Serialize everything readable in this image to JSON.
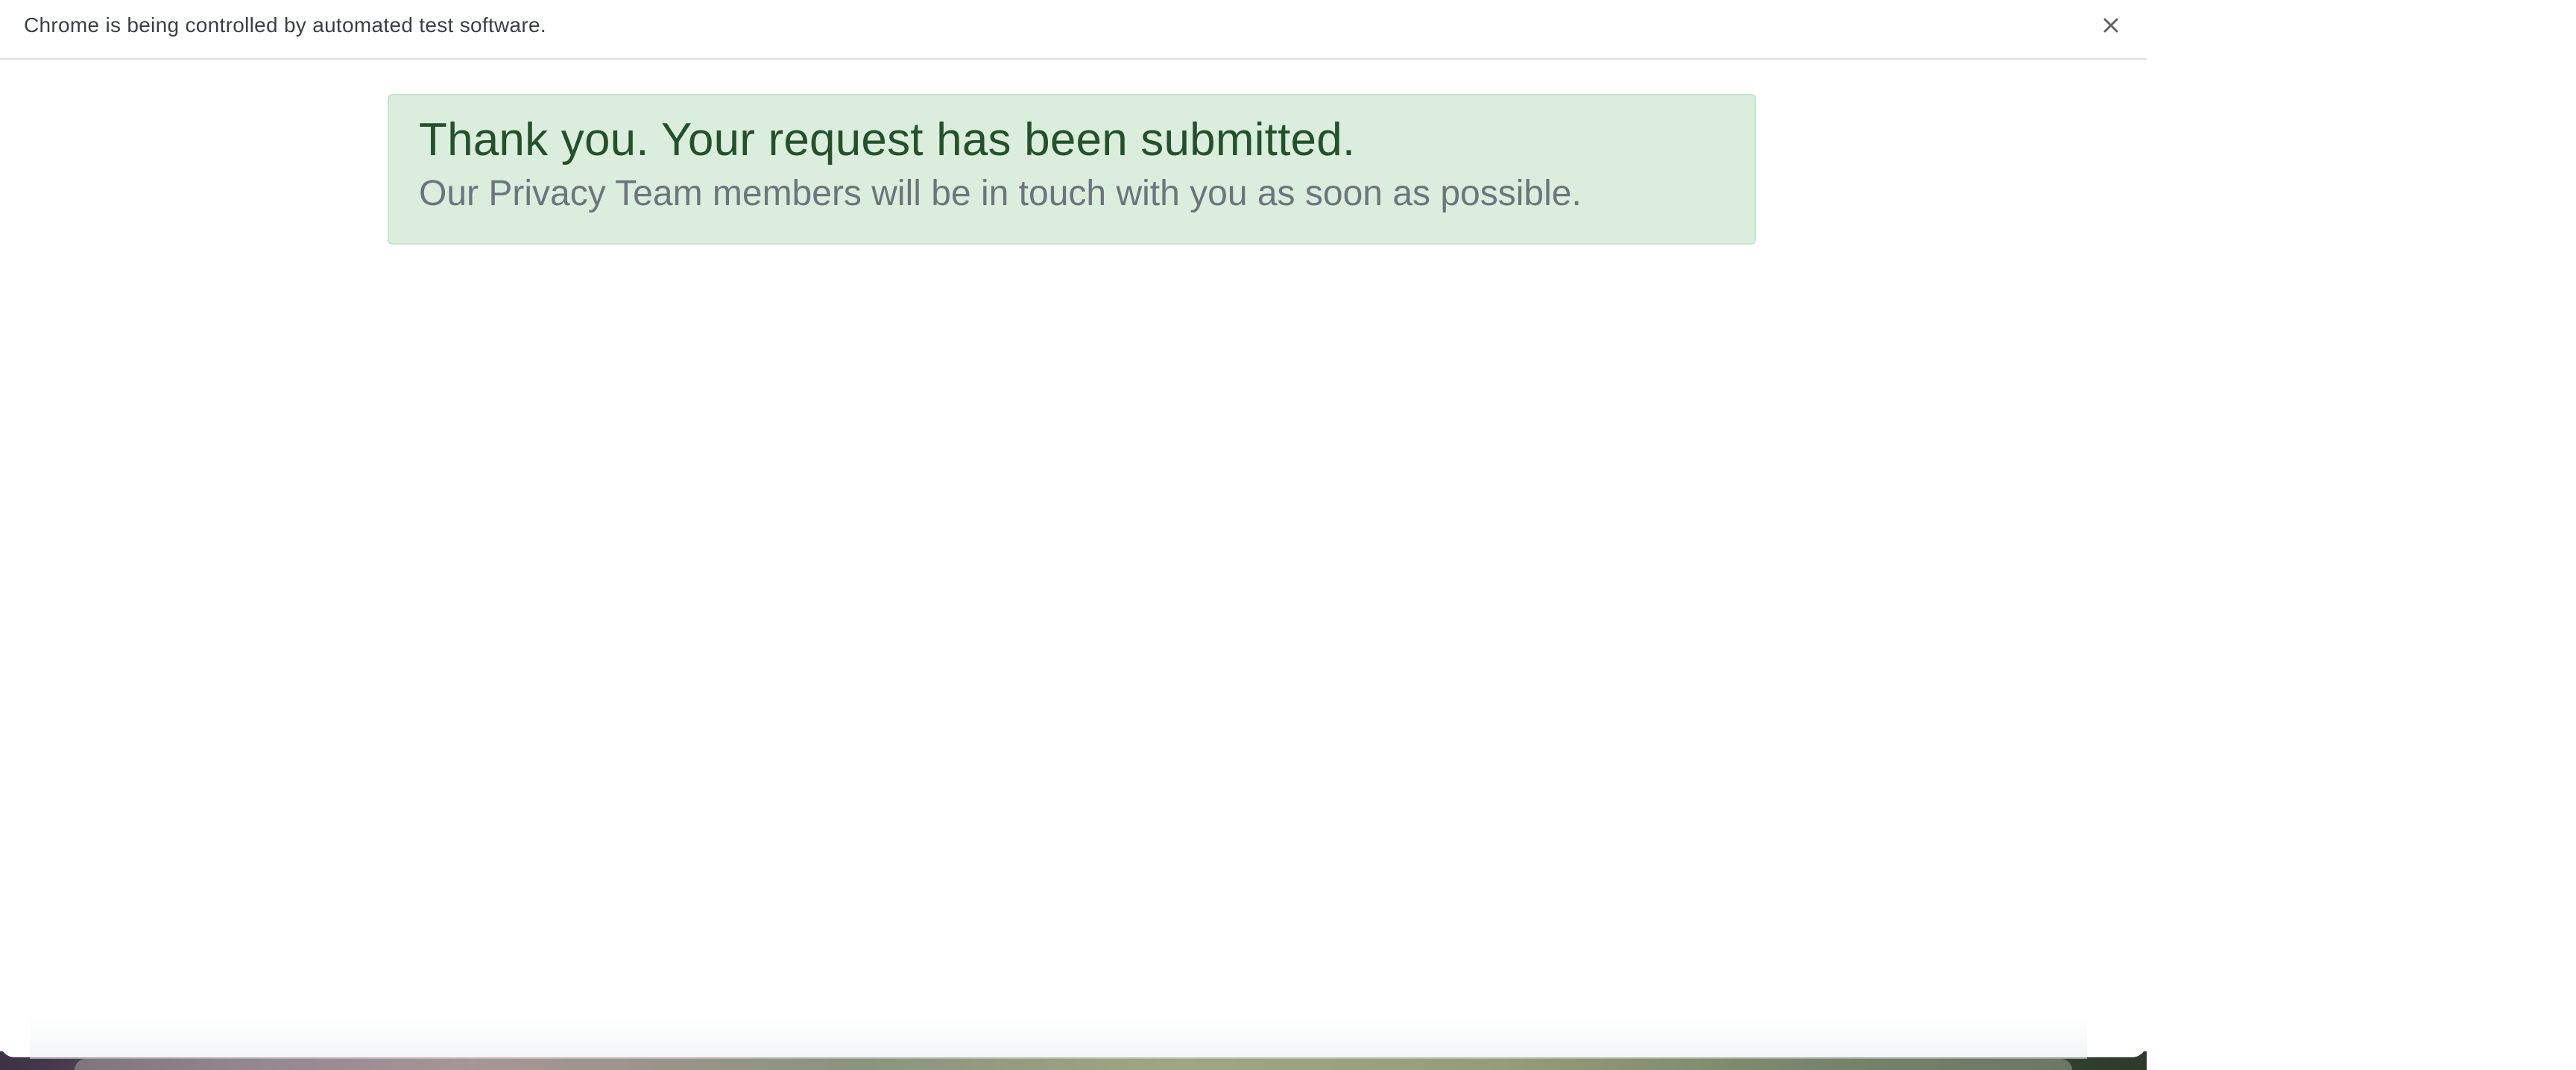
{
  "infobar": {
    "message": "Chrome is being controlled by automated test software.",
    "close_icon": "close-icon"
  },
  "alert": {
    "heading": "Thank you. Your request has been submitted.",
    "body": "Our Privacy Team members will be in touch with you as soon as possible.",
    "background_color": "#dbeedd",
    "heading_color": "#24512b",
    "body_color": "#6c757d"
  }
}
